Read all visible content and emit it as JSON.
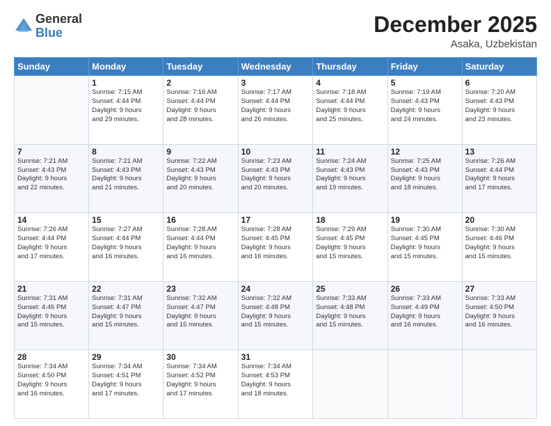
{
  "logo": {
    "general": "General",
    "blue": "Blue"
  },
  "header": {
    "month": "December 2025",
    "location": "Asaka, Uzbekistan"
  },
  "weekdays": [
    "Sunday",
    "Monday",
    "Tuesday",
    "Wednesday",
    "Thursday",
    "Friday",
    "Saturday"
  ],
  "weeks": [
    [
      {
        "num": "",
        "info": ""
      },
      {
        "num": "1",
        "info": "Sunrise: 7:15 AM\nSunset: 4:44 PM\nDaylight: 9 hours\nand 29 minutes."
      },
      {
        "num": "2",
        "info": "Sunrise: 7:16 AM\nSunset: 4:44 PM\nDaylight: 9 hours\nand 28 minutes."
      },
      {
        "num": "3",
        "info": "Sunrise: 7:17 AM\nSunset: 4:44 PM\nDaylight: 9 hours\nand 26 minutes."
      },
      {
        "num": "4",
        "info": "Sunrise: 7:18 AM\nSunset: 4:44 PM\nDaylight: 9 hours\nand 25 minutes."
      },
      {
        "num": "5",
        "info": "Sunrise: 7:19 AM\nSunset: 4:43 PM\nDaylight: 9 hours\nand 24 minutes."
      },
      {
        "num": "6",
        "info": "Sunrise: 7:20 AM\nSunset: 4:43 PM\nDaylight: 9 hours\nand 23 minutes."
      }
    ],
    [
      {
        "num": "7",
        "info": "Sunrise: 7:21 AM\nSunset: 4:43 PM\nDaylight: 9 hours\nand 22 minutes."
      },
      {
        "num": "8",
        "info": "Sunrise: 7:21 AM\nSunset: 4:43 PM\nDaylight: 9 hours\nand 21 minutes."
      },
      {
        "num": "9",
        "info": "Sunrise: 7:22 AM\nSunset: 4:43 PM\nDaylight: 9 hours\nand 20 minutes."
      },
      {
        "num": "10",
        "info": "Sunrise: 7:23 AM\nSunset: 4:43 PM\nDaylight: 9 hours\nand 20 minutes."
      },
      {
        "num": "11",
        "info": "Sunrise: 7:24 AM\nSunset: 4:43 PM\nDaylight: 9 hours\nand 19 minutes."
      },
      {
        "num": "12",
        "info": "Sunrise: 7:25 AM\nSunset: 4:43 PM\nDaylight: 9 hours\nand 18 minutes."
      },
      {
        "num": "13",
        "info": "Sunrise: 7:26 AM\nSunset: 4:44 PM\nDaylight: 9 hours\nand 17 minutes."
      }
    ],
    [
      {
        "num": "14",
        "info": "Sunrise: 7:26 AM\nSunset: 4:44 PM\nDaylight: 9 hours\nand 17 minutes."
      },
      {
        "num": "15",
        "info": "Sunrise: 7:27 AM\nSunset: 4:44 PM\nDaylight: 9 hours\nand 16 minutes."
      },
      {
        "num": "16",
        "info": "Sunrise: 7:28 AM\nSunset: 4:44 PM\nDaylight: 9 hours\nand 16 minutes."
      },
      {
        "num": "17",
        "info": "Sunrise: 7:28 AM\nSunset: 4:45 PM\nDaylight: 9 hours\nand 16 minutes."
      },
      {
        "num": "18",
        "info": "Sunrise: 7:29 AM\nSunset: 4:45 PM\nDaylight: 9 hours\nand 15 minutes."
      },
      {
        "num": "19",
        "info": "Sunrise: 7:30 AM\nSunset: 4:45 PM\nDaylight: 9 hours\nand 15 minutes."
      },
      {
        "num": "20",
        "info": "Sunrise: 7:30 AM\nSunset: 4:46 PM\nDaylight: 9 hours\nand 15 minutes."
      }
    ],
    [
      {
        "num": "21",
        "info": "Sunrise: 7:31 AM\nSunset: 4:46 PM\nDaylight: 9 hours\nand 15 minutes."
      },
      {
        "num": "22",
        "info": "Sunrise: 7:31 AM\nSunset: 4:47 PM\nDaylight: 9 hours\nand 15 minutes."
      },
      {
        "num": "23",
        "info": "Sunrise: 7:32 AM\nSunset: 4:47 PM\nDaylight: 9 hours\nand 15 minutes."
      },
      {
        "num": "24",
        "info": "Sunrise: 7:32 AM\nSunset: 4:48 PM\nDaylight: 9 hours\nand 15 minutes."
      },
      {
        "num": "25",
        "info": "Sunrise: 7:33 AM\nSunset: 4:48 PM\nDaylight: 9 hours\nand 15 minutes."
      },
      {
        "num": "26",
        "info": "Sunrise: 7:33 AM\nSunset: 4:49 PM\nDaylight: 9 hours\nand 16 minutes."
      },
      {
        "num": "27",
        "info": "Sunrise: 7:33 AM\nSunset: 4:50 PM\nDaylight: 9 hours\nand 16 minutes."
      }
    ],
    [
      {
        "num": "28",
        "info": "Sunrise: 7:34 AM\nSunset: 4:50 PM\nDaylight: 9 hours\nand 16 minutes."
      },
      {
        "num": "29",
        "info": "Sunrise: 7:34 AM\nSunset: 4:51 PM\nDaylight: 9 hours\nand 17 minutes."
      },
      {
        "num": "30",
        "info": "Sunrise: 7:34 AM\nSunset: 4:52 PM\nDaylight: 9 hours\nand 17 minutes."
      },
      {
        "num": "31",
        "info": "Sunrise: 7:34 AM\nSunset: 4:53 PM\nDaylight: 9 hours\nand 18 minutes."
      },
      {
        "num": "",
        "info": ""
      },
      {
        "num": "",
        "info": ""
      },
      {
        "num": "",
        "info": ""
      }
    ]
  ]
}
